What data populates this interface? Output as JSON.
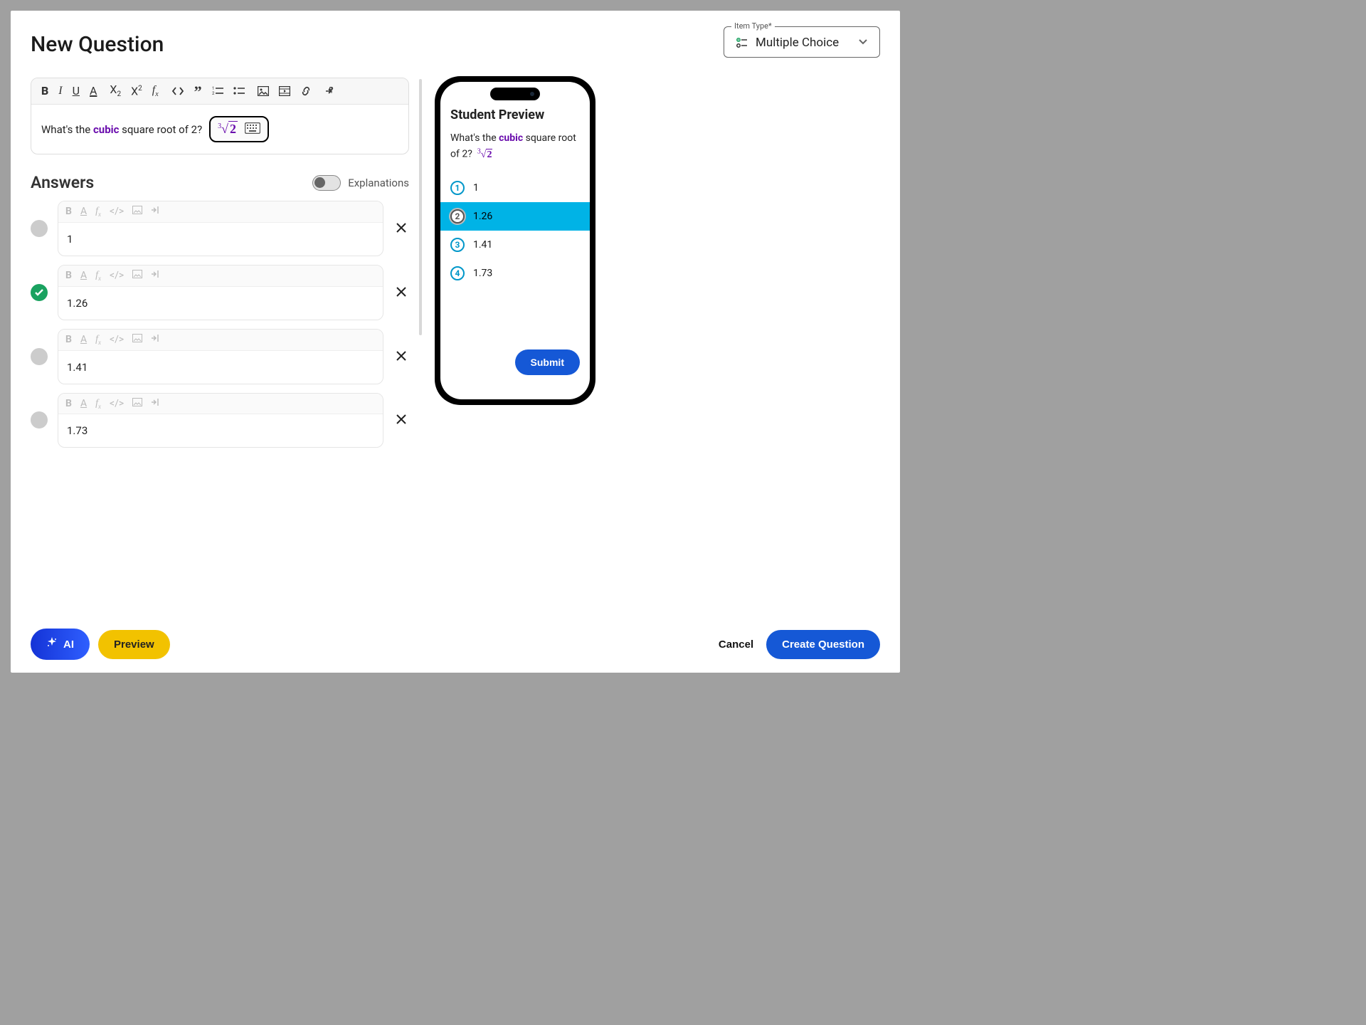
{
  "itemType": {
    "legend": "Item Type*",
    "value": "Multiple Choice"
  },
  "pageTitle": "New Question",
  "question": {
    "prefix": "What's the ",
    "emph": "cubic",
    "suffix": " square root of 2?",
    "mathGlyph": "∛2"
  },
  "answersSection": {
    "title": "Answers",
    "explanationsLabel": "Explanations",
    "explanationsOn": false
  },
  "answers": [
    {
      "text": "1",
      "correct": false
    },
    {
      "text": "1.26",
      "correct": true
    },
    {
      "text": "1.41",
      "correct": false
    },
    {
      "text": "1.73",
      "correct": false
    }
  ],
  "preview": {
    "title": "Student Preview",
    "submit": "Submit",
    "selectedIndex": 1,
    "options": [
      "1",
      "1.26",
      "1.41",
      "1.73"
    ]
  },
  "footer": {
    "ai": "AI",
    "preview": "Preview",
    "cancel": "Cancel",
    "create": "Create Question"
  }
}
